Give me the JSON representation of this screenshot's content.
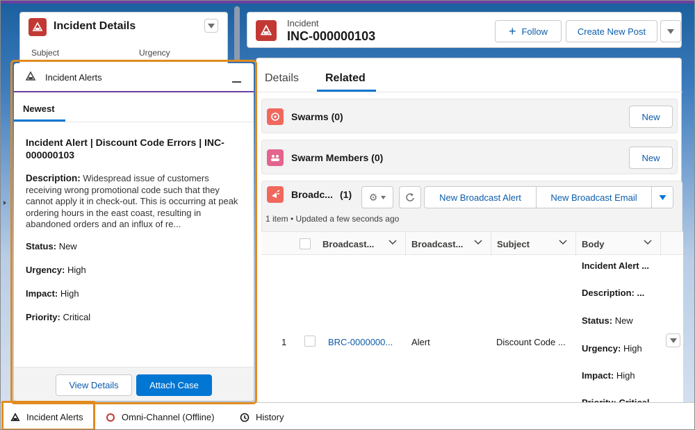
{
  "incident_details": {
    "title": "Incident Details",
    "field_subject": "Subject",
    "field_urgency": "Urgency"
  },
  "alerts_panel": {
    "title": "Incident Alerts",
    "tab_newest": "Newest",
    "alert_title": "Incident Alert | Discount Code Errors | INC-000000103",
    "description_label": "Description:",
    "description_text": "Widespread issue of customers receiving wrong promotional code such that they cannot apply it in check-out. This is occurring at peak ordering hours in the east coast, resulting in abandoned orders and an influx of re...",
    "status_label": "Status:",
    "status_value": "New",
    "urgency_label": "Urgency:",
    "urgency_value": "High",
    "impact_label": "Impact:",
    "impact_value": "High",
    "priority_label": "Priority:",
    "priority_value": "Critical",
    "view_details": "View Details",
    "attach_case": "Attach Case"
  },
  "record_header": {
    "object_label": "Incident",
    "record_name": "INC-000000103",
    "follow": "Follow",
    "create_post": "Create New Post"
  },
  "tabs": {
    "details": "Details",
    "related": "Related"
  },
  "related": {
    "swarms_title": "Swarms (0)",
    "swarm_members_title": "Swarm Members (0)",
    "new_label": "New",
    "broadcast_title": "Broadc...",
    "broadcast_count": "(1)",
    "broadcast_meta": "1 item • Updated a few seconds ago",
    "new_broadcast_alert": "New Broadcast Alert",
    "new_broadcast_email": "New Broadcast Email",
    "columns": [
      "Broadcast...",
      "Broadcast...",
      "Subject",
      "Body"
    ],
    "row": {
      "num": "1",
      "name": "BRC-0000000...",
      "type": "Alert",
      "subject": "Discount Code ...",
      "body_title": "Incident Alert ...",
      "body_description": "Description: ...",
      "body_status_label": "Status:",
      "body_status_value": "New",
      "body_urgency_label": "Urgency:",
      "body_urgency_value": "High",
      "body_impact_label": "Impact:",
      "body_impact_value": "High",
      "body_priority_partial": "Priority: Critical"
    }
  },
  "utility_bar": {
    "incident_alerts": "Incident Alerts",
    "omni_channel": "Omni-Channel (Offline)",
    "history": "History"
  },
  "colors": {
    "brand_blue": "#0176d3",
    "incident_red": "#c23934",
    "highlight_orange": "#e08b1f",
    "panel_purple": "#6b3fa0"
  }
}
